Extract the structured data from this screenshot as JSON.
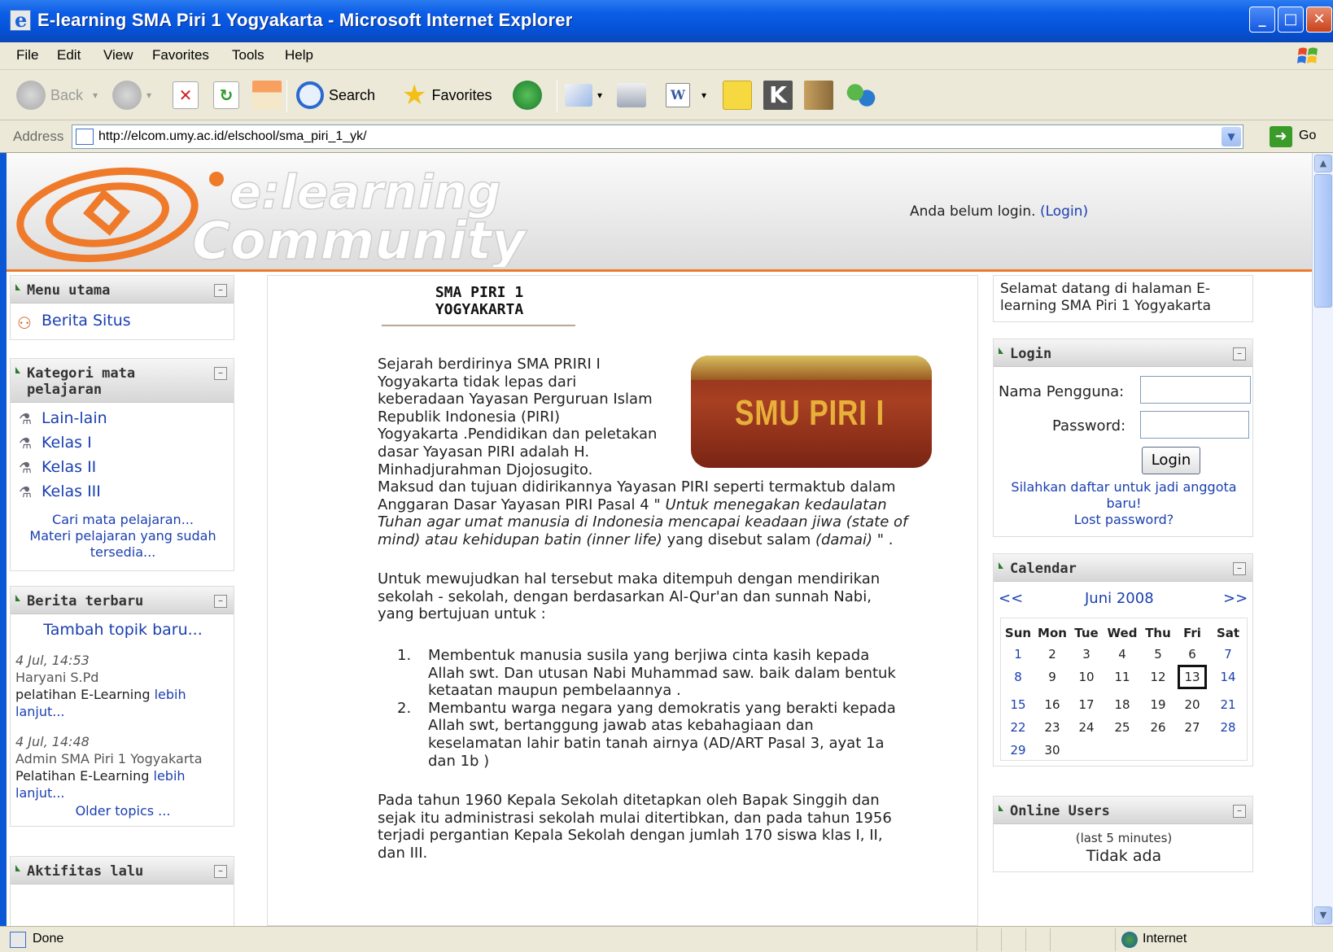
{
  "window": {
    "title": "E-learning SMA Piri 1 Yogyakarta - Microsoft Internet Explorer",
    "minimize": "_",
    "maximize": "□",
    "close": "✕"
  },
  "menubar": [
    "File",
    "Edit",
    "View",
    "Favorites",
    "Tools",
    "Help"
  ],
  "toolbar": {
    "back": "Back",
    "search": "Search",
    "favorites": "Favorites"
  },
  "address": {
    "label": "Address",
    "url": "http://elcom.umy.ac.id/elschool/sma_piri_1_yk/",
    "go": "Go"
  },
  "banner": {
    "logo_line1": "e:learning",
    "logo_line2": "Community",
    "login_status": "Anda belum login.",
    "login_link": "(Login)"
  },
  "left": {
    "menu_utama": {
      "title": "Menu utama",
      "items": [
        "Berita Situs"
      ]
    },
    "kategori": {
      "title_line1": "Kategori mata",
      "title_line2": "pelajaran",
      "items": [
        "Lain-lain",
        "Kelas I",
        "Kelas II",
        "Kelas III"
      ],
      "search_link": "Cari mata pelajaran...",
      "all_link_line1": "Materi pelajaran yang sudah",
      "all_link_line2": "tersedia..."
    },
    "berita": {
      "title": "Berita terbaru",
      "add_link": "Tambah topik baru...",
      "posts": [
        {
          "date": "4 Jul, 14:53",
          "author": "Haryani S.Pd",
          "text": "pelatihan E-Learning",
          "more1": "lebih",
          "more2": "lanjut..."
        },
        {
          "date": "4 Jul, 14:48",
          "author": "Admin SMA Piri 1 Yogyakarta",
          "text": "Pelatihan E-Learning",
          "more1": "lebih",
          "more2": "lanjut..."
        }
      ],
      "older": "Older topics ..."
    },
    "aktifitas": {
      "title": "Aktifitas lalu"
    }
  },
  "main": {
    "title_line1": "SMA PIRI 1",
    "title_line2": "YOGYAKARTA",
    "photo_text": "SMU PIRI I",
    "intro_lines": [
      "Sejarah berdirinya SMA PRIRI I",
      "Yogyakarta tidak lepas dari",
      "keberadaan Yayasan Perguruan Islam",
      "Republik Indonesia (PIRI)",
      "Yogyakarta .Pendidikan dan peletakan",
      "dasar Yayasan PIRI adalah H.",
      "Minhadjurahman Djojosugito."
    ],
    "maksud_line1": "Maksud dan tujuan didirikannya Yayasan PIRI seperti termaktub dalam",
    "maksud_line2a": "Anggaran Dasar Yayasan PIRI Pasal 4 \" ",
    "maksud_line2b": "Untuk menegakan kedaulatan",
    "maksud_line3": "Tuhan agar umat manusia di Indonesia mencapai keadaan jiwa (state of",
    "maksud_line4a": "mind) atau kehidupan batin (inner life)",
    "maksud_line4b": " yang disebut salam ",
    "maksud_line4c": "(damai)",
    "maksud_line4d": " \" .",
    "untuk_lines": [
      "Untuk mewujudkan hal tersebut maka ditempuh dengan mendirikan",
      "sekolah - sekolah, dengan berdasarkan Al-Qur'an dan sunnah Nabi,",
      "yang bertujuan untuk :"
    ],
    "goals": [
      {
        "num": "1.",
        "lines": [
          "Membentuk manusia susila yang berjiwa cinta kasih kepada",
          "Allah swt. Dan utusan Nabi Muhammad saw. baik dalam bentuk",
          "ketaatan maupun pembelaannya ."
        ]
      },
      {
        "num": "2.",
        "lines": [
          "Membantu warga negara yang demokratis yang berakti kepada",
          "Allah swt, bertanggung jawab atas kebahagiaan dan",
          "keselamatan lahir batin tanah airnya (AD/ART Pasal 3, ayat 1a",
          "dan 1b )"
        ]
      }
    ],
    "tahun_lines": [
      "Pada tahun 1960 Kepala Sekolah ditetapkan oleh Bapak Singgih dan",
      "sejak itu administrasi sekolah mulai ditertibkan, dan pada tahun 1956",
      "terjadi pergantian Kepala Sekolah dengan jumlah 170 siswa klas I, II,",
      "dan III."
    ]
  },
  "right": {
    "welcome_line1": "Selamat datang di halaman E-",
    "welcome_line2": "learning SMA Piri 1 Yogyakarta",
    "login": {
      "title": "Login",
      "username_label": "Nama Pengguna:",
      "password_label": "Password:",
      "button": "Login",
      "signup_line1": "Silahkan daftar untuk jadi anggota",
      "signup_line2": "baru!",
      "lost": "Lost password?"
    },
    "calendar": {
      "title": "Calendar",
      "prev": "<<",
      "month": "Juni 2008",
      "next": ">>",
      "days": [
        "Sun",
        "Mon",
        "Tue",
        "Wed",
        "Thu",
        "Fri",
        "Sat"
      ],
      "weeks": [
        [
          "1",
          "2",
          "3",
          "4",
          "5",
          "6",
          "7"
        ],
        [
          "8",
          "9",
          "10",
          "11",
          "12",
          "13",
          "14"
        ],
        [
          "15",
          "16",
          "17",
          "18",
          "19",
          "20",
          "21"
        ],
        [
          "22",
          "23",
          "24",
          "25",
          "26",
          "27",
          "28"
        ],
        [
          "29",
          "30",
          "",
          "",
          "",
          "",
          ""
        ]
      ],
      "today": "13"
    },
    "online": {
      "title": "Online Users",
      "sub": "(last 5 minutes)",
      "none": "Tidak ada"
    }
  },
  "statusbar": {
    "text": "Done",
    "zone": "Internet"
  }
}
